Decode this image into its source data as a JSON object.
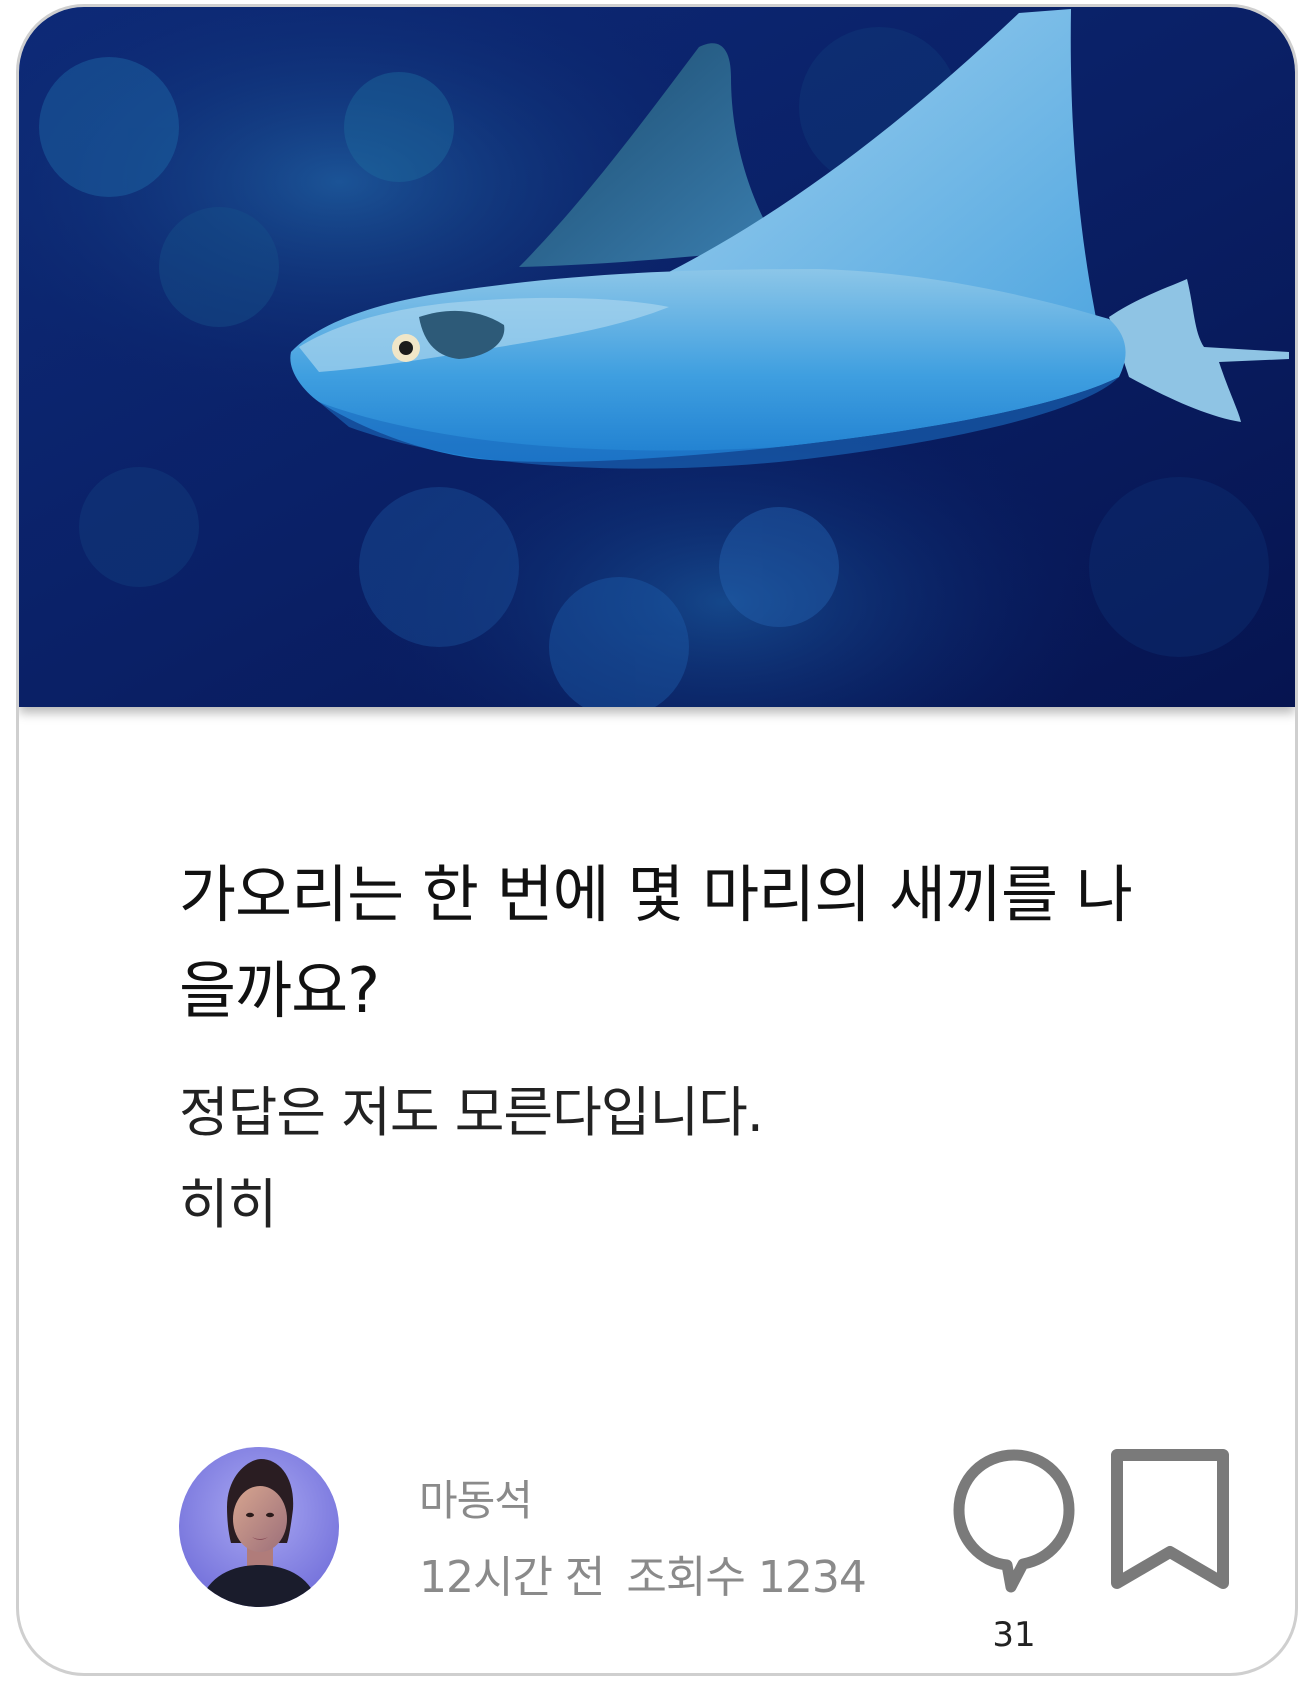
{
  "post": {
    "image": {
      "subject": "manta-ray-photo",
      "colors": {
        "deep_water": "#0a1a5c",
        "water_mid": "#0b3b8a",
        "ray_body": "#3a9ee0",
        "ray_top": "#7fb8dc"
      }
    },
    "title": "가오리는 한 번에 몇 마리의 새끼를 나을까요?",
    "body_lines": [
      "정답은 저도 모른다입니다.",
      "히히"
    ],
    "author": {
      "name": "마동석",
      "avatar_icon": "avatar-portrait-icon"
    },
    "meta": {
      "time": "12시간 전",
      "views": "조회수 1234"
    },
    "actions": {
      "comment_icon": "speech-bubble-icon",
      "comment_count": "31",
      "bookmark_icon": "bookmark-icon"
    },
    "colors": {
      "card_border": "#cfcfcf",
      "muted_text": "#8a8a8a",
      "icon_gray": "#7a7a7a"
    }
  }
}
